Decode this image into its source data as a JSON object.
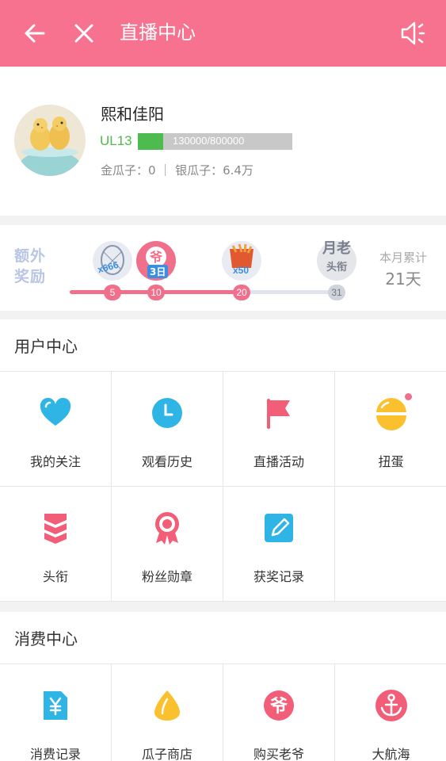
{
  "header": {
    "title": "直播中心",
    "back_icon": "arrow-left-icon",
    "close_icon": "close-icon",
    "sound_icon": "speaker-icon"
  },
  "profile": {
    "username": "熙和佳阳",
    "level": "UL13",
    "xp_text": "130000/800000",
    "xp_progress": 0.1625,
    "coins": "金瓜子：0 ｜ 银瓜子：6.4万"
  },
  "reward": {
    "label_line1": "额外",
    "label_line2": "奖励",
    "progress_days": 20,
    "milestones": [
      {
        "day": "5",
        "badge": "x666",
        "reached": true
      },
      {
        "day": "10",
        "badge": "3日",
        "reached": true
      },
      {
        "day": "20",
        "badge": "x50",
        "reached": true
      },
      {
        "day": "31",
        "badge_top": "月老",
        "badge_bottom": "头衔",
        "reached": false
      }
    ],
    "monthly_label": "本月累计",
    "monthly_value": "21天"
  },
  "user_center": {
    "title": "用户中心",
    "items": [
      {
        "label": "我的关注",
        "icon": "heart-icon"
      },
      {
        "label": "观看历史",
        "icon": "clock-icon"
      },
      {
        "label": "直播活动",
        "icon": "flag-icon"
      },
      {
        "label": "扭蛋",
        "icon": "capsule-icon"
      },
      {
        "label": "头衔",
        "icon": "chevrons-icon"
      },
      {
        "label": "粉丝勋章",
        "icon": "medal-icon"
      },
      {
        "label": "获奖记录",
        "icon": "edit-icon"
      }
    ]
  },
  "consume_center": {
    "title": "消费中心",
    "items": [
      {
        "label": "消费记录",
        "icon": "yen-receipt-icon"
      },
      {
        "label": "瓜子商店",
        "icon": "seed-icon"
      },
      {
        "label": "购买老爷",
        "icon": "ye-badge-icon"
      },
      {
        "label": "大航海",
        "icon": "anchor-icon"
      }
    ]
  },
  "colors": {
    "brand_pink": "#f7728f",
    "level_green": "#4dbb4d",
    "icon_blue": "#2fb4e6",
    "icon_red": "#f25d78",
    "icon_yellow": "#fbc02d"
  }
}
